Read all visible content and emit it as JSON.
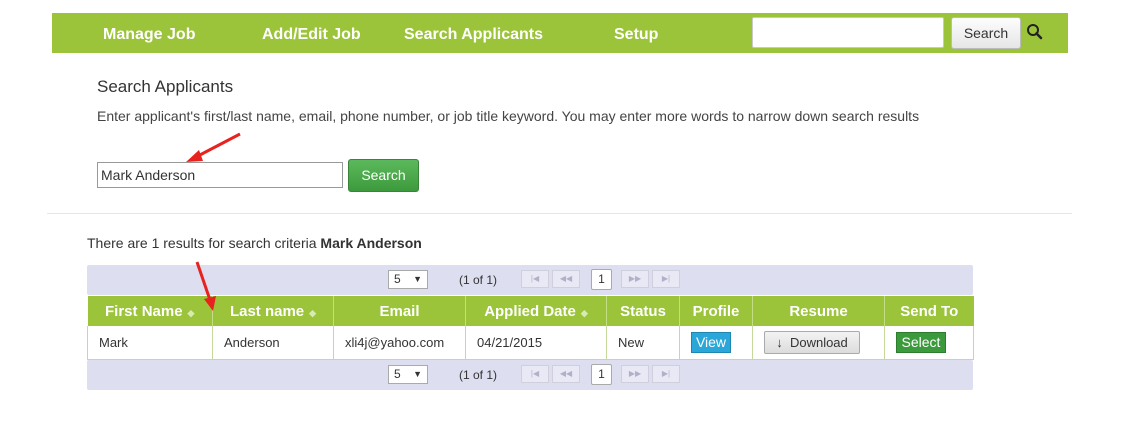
{
  "nav": {
    "items": [
      {
        "label": "Manage Job"
      },
      {
        "label": "Add/Edit Job"
      },
      {
        "label": "Search Applicants"
      },
      {
        "label": "Setup"
      }
    ],
    "search_value": "",
    "search_button": "Search",
    "icon": "search-icon",
    "color": "#9bc43a"
  },
  "search": {
    "title": "Search Applicants",
    "instructions": "Enter applicant's first/last name, email, phone number, or job title keyword. You may enter more words to narrow down search results",
    "input_value": "Mark Anderson",
    "button_label": "Search"
  },
  "results": {
    "summary_prefix": "There are 1 results for search criteria",
    "summary_term": "Mark Anderson",
    "pager": {
      "per_page": "5",
      "count_text": "(1 of 1)",
      "current_page": "1",
      "nav_icons": [
        "first-page-icon",
        "prev-page-icon",
        "next-page-icon",
        "last-page-icon"
      ]
    },
    "columns": [
      "First Name",
      "Last name",
      "Email",
      "Applied Date",
      "Status",
      "Profile",
      "Resume",
      "Send To"
    ],
    "rows": [
      {
        "first_name": "Mark",
        "last_name": "Anderson",
        "email": "xli4j@yahoo.com",
        "applied_date": "04/21/2015",
        "status": "New",
        "profile_label": "View",
        "resume_label": "Download",
        "send_to_label": "Select"
      }
    ]
  },
  "colors": {
    "accent_green": "#9bc43a",
    "annotation_red": "#e8231f",
    "view_blue": "#2aa6d9",
    "select_green": "#3b9a3b"
  }
}
